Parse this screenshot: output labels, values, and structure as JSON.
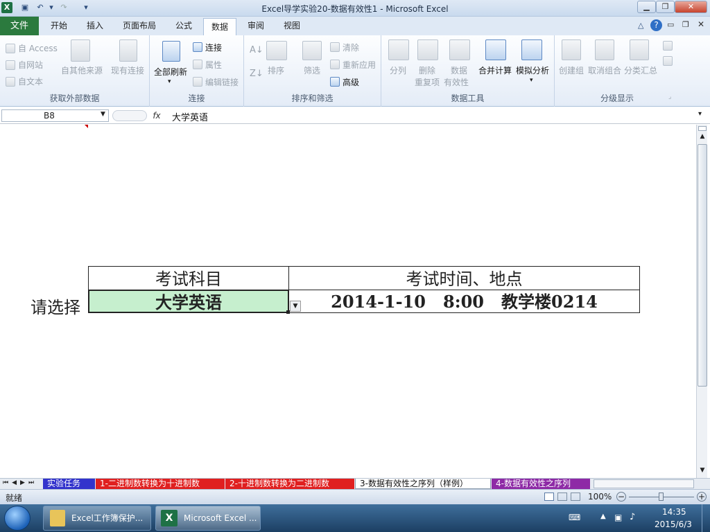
{
  "window": {
    "title": "Excel导学实验20-数据有效性1  -  Microsoft Excel"
  },
  "ribbon_tabs": [
    "文件",
    "开始",
    "插入",
    "页面布局",
    "公式",
    "数据",
    "审阅",
    "视图"
  ],
  "groups": {
    "external": {
      "label": "获取外部数据",
      "access": "自 Access",
      "web": "自网站",
      "text": "自文本",
      "other": "自其他来源",
      "existing": "现有连接"
    },
    "connections": {
      "label": "连接",
      "refresh_all": "全部刷新",
      "connect": "连接",
      "props": "属性",
      "edit_links": "编辑链接"
    },
    "sort_filter": {
      "label": "排序和筛选",
      "sort": "排序",
      "filter": "筛选",
      "clear": "清除",
      "reapply": "重新应用",
      "advanced": "高级"
    },
    "data_tools": {
      "label": "数据工具",
      "split": "分列",
      "remove_dup_1": "删除",
      "remove_dup_2": "重复项",
      "validation_1": "数据",
      "validation_2": "有效性",
      "consolidate": "合并计算",
      "whatif": "模拟分析"
    },
    "outline": {
      "label": "分级显示",
      "group": "创建组",
      "ungroup": "取消组合",
      "subtotal": "分类汇总"
    }
  },
  "formula_bar": {
    "name_box": "B8",
    "fx": "fx",
    "value": "大学英语"
  },
  "sheet": {
    "prompt": "请选择",
    "header_subject": "考试科目",
    "header_time": "考试时间、地点",
    "selected_subject": "大学英语",
    "exam_info": "2014-1-10   8:00   教学楼0214"
  },
  "sheet_tabs": [
    {
      "label": "实验任务",
      "bg": "#3333cc",
      "fg": "#ffffff"
    },
    {
      "label": "1-二进制数转换为十进制数",
      "bg": "#e02020",
      "fg": "#ffffff"
    },
    {
      "label": "2-十进制数转换为二进制数",
      "bg": "#e02020",
      "fg": "#ffffff"
    },
    {
      "label": "3-数据有效性之序列（样例）",
      "bg": "#ffffff",
      "fg": "#111111"
    },
    {
      "label": "4-数据有效性之序列",
      "bg": "#8e2aa6",
      "fg": "#ffffff"
    }
  ],
  "status": {
    "ready": "就绪",
    "zoom": "100%"
  },
  "taskbar": {
    "item1": "Excel工作簿保护...",
    "item2": "Microsoft Excel ...",
    "time": "14:35",
    "date": "2015/6/3"
  },
  "colors": {
    "selected_cell_bg": "#c6efce",
    "file_tab": "#2b7a3e"
  }
}
